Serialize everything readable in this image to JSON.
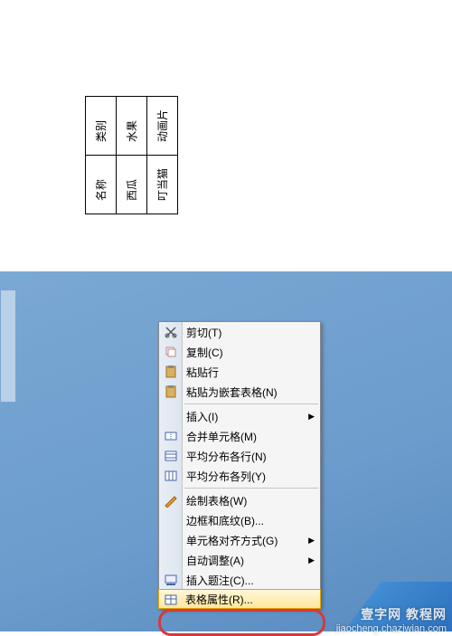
{
  "table": {
    "rows": [
      [
        "名称",
        "类别"
      ],
      [
        "西瓜",
        "水果"
      ],
      [
        "叮当猫",
        "动画片"
      ]
    ]
  },
  "menu": {
    "items": [
      {
        "label": "剪切(T)",
        "icon": "cut-icon",
        "arrow": false
      },
      {
        "label": "复制(C)",
        "icon": "copy-icon",
        "arrow": false
      },
      {
        "label": "粘贴行",
        "icon": "paste-row-icon",
        "arrow": false
      },
      {
        "label": "粘贴为嵌套表格(N)",
        "icon": "paste-nested-icon",
        "arrow": false
      },
      {
        "sep": true
      },
      {
        "label": "插入(I)",
        "icon": "",
        "arrow": true
      },
      {
        "label": "合并单元格(M)",
        "icon": "merge-cells-icon",
        "arrow": false
      },
      {
        "label": "平均分布各行(N)",
        "icon": "dist-rows-icon",
        "arrow": false
      },
      {
        "label": "平均分布各列(Y)",
        "icon": "dist-cols-icon",
        "arrow": false
      },
      {
        "sep": true
      },
      {
        "label": "绘制表格(W)",
        "icon": "draw-table-icon",
        "arrow": false
      },
      {
        "label": "边框和底纹(B)...",
        "icon": "",
        "arrow": false
      },
      {
        "label": "单元格对齐方式(G)",
        "icon": "",
        "arrow": true
      },
      {
        "label": "自动调整(A)",
        "icon": "",
        "arrow": true
      },
      {
        "label": "插入题注(C)...",
        "icon": "caption-icon",
        "arrow": false
      },
      {
        "label": "表格属性(R)...",
        "icon": "table-props-icon",
        "arrow": false,
        "highlighted": true
      }
    ]
  },
  "watermark": {
    "line1": "壹字网 教程网",
    "line2": "jiaocheng.chaziwian.com"
  }
}
